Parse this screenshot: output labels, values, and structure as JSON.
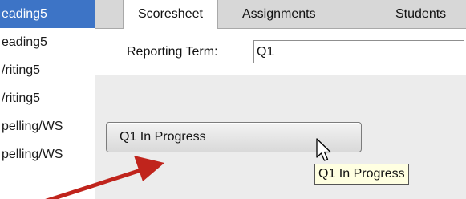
{
  "sidebar": {
    "items": [
      {
        "label": "eading5",
        "selected": true
      },
      {
        "label": "eading5",
        "selected": false
      },
      {
        "label": "/riting5",
        "selected": false
      },
      {
        "label": "/riting5",
        "selected": false
      },
      {
        "label": "pelling/WS",
        "selected": false
      },
      {
        "label": "pelling/WS",
        "selected": false
      }
    ]
  },
  "tabs": [
    {
      "label": "Scoresheet",
      "active": true
    },
    {
      "label": "Assignments",
      "active": false
    },
    {
      "label": "Students",
      "active": false
    }
  ],
  "reporting_term": {
    "label": "Reporting Term:",
    "value": "Q1"
  },
  "status_button": {
    "label": "Q1 In Progress"
  },
  "tooltip": {
    "text": "Q1 In Progress"
  },
  "colors": {
    "selection": "#3d74c6",
    "annotation_arrow": "#c0241c",
    "tooltip_bg": "#ffffe1"
  }
}
